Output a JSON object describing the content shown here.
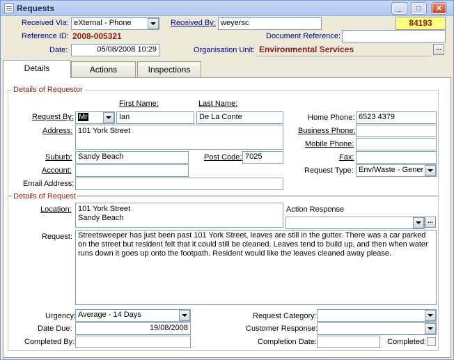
{
  "window": {
    "title": "Requests",
    "buttons": [
      "minimize",
      "maximize",
      "close"
    ]
  },
  "header": {
    "received_via_label": "Received Via:",
    "received_via_value": "eXternal - Phone",
    "received_by_label": "Received By:",
    "received_by_value": "weyersc",
    "request_number": "84193",
    "reference_id_label": "Reference ID:",
    "reference_id_value": "2008-005321",
    "document_reference_label": "Document Reference:",
    "document_reference_value": "",
    "date_label": "Date:",
    "date_value": "05/08/2008 10:29",
    "org_unit_label": "Organisation Unit:",
    "org_unit_value": "Environmental Services",
    "org_unit_button": "..."
  },
  "tabs": [
    {
      "label": "Details",
      "active": true
    },
    {
      "label": "Actions",
      "active": false
    },
    {
      "label": "Inspections",
      "active": false
    }
  ],
  "requestor": {
    "group_title": "Details of Requestor",
    "first_name_label": "First Name:",
    "last_name_label": "Last Name:",
    "request_by_label": "Request By:",
    "title_value": "Mr",
    "first_name_value": "Ian",
    "last_name_value": "De La Conte",
    "address_label": "Address:",
    "address_value": "101 York Street",
    "suburb_label": "Suburb:",
    "suburb_value": "Sandy Beach",
    "post_code_label": "Post Code:",
    "post_code_value": "7025",
    "account_label": "Account:",
    "account_value": "",
    "email_label": "Email Address:",
    "email_value": "",
    "home_phone_label": "Home Phone:",
    "home_phone_value": "6523 4379",
    "business_phone_label": "Business Phone:",
    "business_phone_value": "",
    "mobile_phone_label": "Mobile Phone:",
    "mobile_phone_value": "",
    "fax_label": "Fax:",
    "fax_value": "",
    "request_type_label": "Request Type:",
    "request_type_value": "Env/Waste - Gener"
  },
  "request": {
    "group_title": "Details of Request",
    "location_label": "Location:",
    "location_line1": "101 York Street",
    "location_line2": "Sandy Beach",
    "action_response_label": "Action Response",
    "action_response_value": "",
    "action_response_button": "...",
    "request_label": "Request:",
    "request_text": "Streetsweeper has just been past 101 York Street, leaves are still in the gutter. There was a car parked on the street but resident felt that it could still be cleaned. Leaves tend to build up, and then when water runs down it goes up onto the footpath. Resident would like the leaves cleaned away please.",
    "urgency_label": "Urgency:",
    "urgency_value": "Average - 14 Days",
    "date_due_label": "Date Due:",
    "date_due_value": "19/08/2008",
    "completed_by_label": "Completed By:",
    "completed_by_value": "",
    "request_category_label": "Request Category:",
    "request_category_value": "",
    "customer_response_label": "Customer Response:",
    "customer_response_value": "",
    "completion_date_label": "Completion Date:",
    "completion_date_value": "",
    "completed_label": "Completed:",
    "completed_checked": false
  },
  "colors": {
    "window_bg": "#ece9d8",
    "accent_red": "#8b1a1a",
    "label_blue": "#00008b",
    "highlight_yellow": "#ffff80"
  }
}
